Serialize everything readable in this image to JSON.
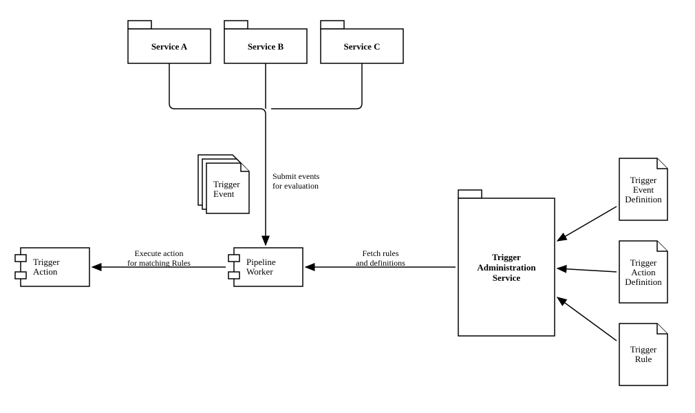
{
  "nodes": {
    "service_a": "Service A",
    "service_b": "Service B",
    "service_c": "Service C",
    "trigger_event_line1": "Trigger",
    "trigger_event_line2": "Event",
    "pipeline_worker_line1": "Pipeline",
    "pipeline_worker_line2": "Worker",
    "trigger_action_line1": "Trigger",
    "trigger_action_line2": "Action",
    "admin_line1": "Trigger",
    "admin_line2": "Administration",
    "admin_line3": "Service",
    "event_def_line1": "Trigger",
    "event_def_line2": "Event",
    "event_def_line3": "Definition",
    "action_def_line1": "Trigger",
    "action_def_line2": "Action",
    "action_def_line3": "Definition",
    "rule_line1": "Trigger",
    "rule_line2": "Rule"
  },
  "edges": {
    "submit_line1": "Submit events",
    "submit_line2": "for evaluation",
    "fetch_line1": "Fetch rules",
    "fetch_line2": "and definitions",
    "execute_line1": "Execute action",
    "execute_line2": "for matching Rules"
  }
}
